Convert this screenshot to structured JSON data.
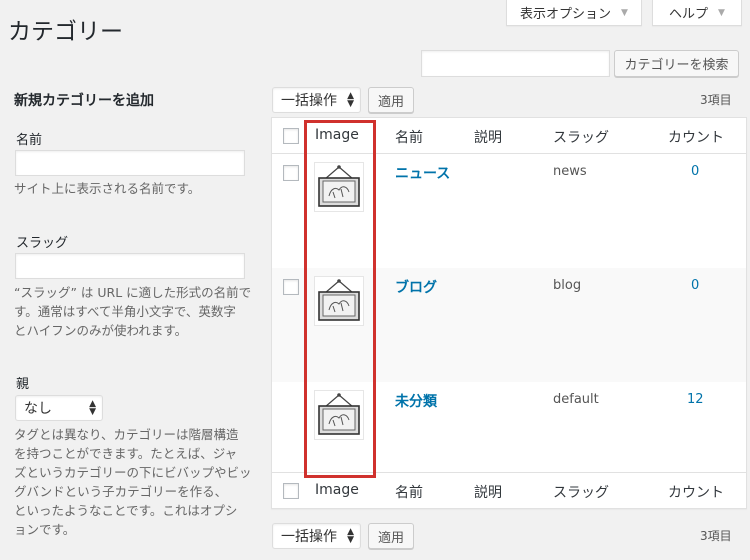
{
  "screen_options": "表示オプション",
  "help": "ヘルプ",
  "page_title": "カテゴリー",
  "search": {
    "placeholder": "",
    "button": "カテゴリーを検索"
  },
  "form": {
    "heading": "新規カテゴリーを追加",
    "name_label": "名前",
    "name_value": "",
    "name_desc": "サイト上に表示される名前です。",
    "slug_label": "スラッグ",
    "slug_value": "",
    "slug_desc_1": "“スラッグ” は URL に適した形式の名前で",
    "slug_desc_2": "す。通常はすべて半角小文字で、英数字",
    "slug_desc_3": "とハイフンのみが使われます。",
    "parent_label": "親",
    "parent_value": "なし",
    "parent_desc_1": "タグとは異なり、カテゴリーは階層構造",
    "parent_desc_2": "を持つことができます。たとえば、ジャ",
    "parent_desc_3": "ズというカテゴリーの下にビバップやビッ",
    "parent_desc_4": "グバンドという子カテゴリーを作る、",
    "parent_desc_5": "といったようなことです。これはオプシ",
    "parent_desc_6": "ョンです。"
  },
  "bulk": {
    "top_label": "一括操作",
    "apply": "適用",
    "bottom_label": "一括操作"
  },
  "item_count": "3項目",
  "columns": {
    "image": "Image",
    "name": "名前",
    "description": "説明",
    "slug": "スラッグ",
    "count": "カウント"
  },
  "rows": [
    {
      "name": "ニュース",
      "description": "",
      "slug": "news",
      "count": "0"
    },
    {
      "name": "ブログ",
      "description": "",
      "slug": "blog",
      "count": "0"
    },
    {
      "name": "未分類",
      "description": "",
      "slug": "default",
      "count": "12"
    }
  ],
  "colors": {
    "link": "#0073aa",
    "highlight": "#d0312d",
    "background": "#f1f1f1"
  },
  "icons": {
    "thumbnail": "picture-frame-icon",
    "dropdown": "updown-chevron-icon"
  }
}
